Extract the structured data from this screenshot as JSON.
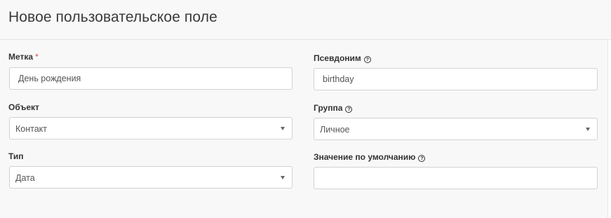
{
  "title": "Новое пользовательское поле",
  "fields": {
    "label": {
      "label": "Метка",
      "required_mark": "*",
      "value": "День рождения"
    },
    "alias": {
      "label": "Псевдоним",
      "help": "?",
      "value": "birthday"
    },
    "object": {
      "label": "Объект",
      "value": "Контакт"
    },
    "group": {
      "label": "Группа",
      "help": "?",
      "value": "Личное"
    },
    "type": {
      "label": "Тип",
      "value": "Дата"
    },
    "default": {
      "label": "Значение по умолчанию",
      "help": "?",
      "value": ""
    }
  },
  "colors": {
    "required": "#e04b4b",
    "border": "#d2d2d2",
    "background": "#f8f8f8"
  }
}
